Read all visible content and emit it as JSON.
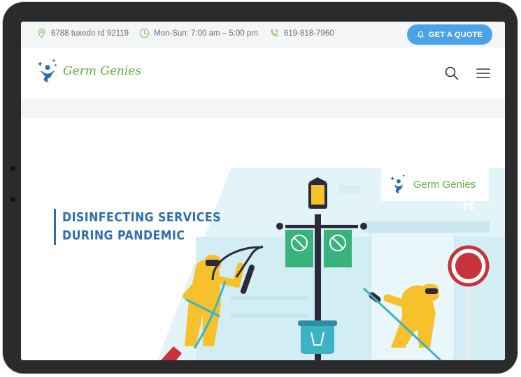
{
  "topbar": {
    "address": "6788 tuxedo rd 92119",
    "hours": "Mon-Sun: 7:00 am – 5:00 pm",
    "phone": "619-818-7960",
    "quote_label": "GET A QUOTE"
  },
  "header": {
    "logo_text": "Germ Genies"
  },
  "hero": {
    "line1": "DISINFECTING SERVICES",
    "line2": "DURING PANDEMIC",
    "badge_text": "Germ Genies",
    "sign_letter": "R"
  },
  "colors": {
    "accent_blue": "#4aa3e6",
    "logo_green": "#6aaa3a",
    "headline_blue": "#2f6db2",
    "suit_yellow": "#f6c12b",
    "banner_green": "#39b37d"
  },
  "icons": [
    "location-icon",
    "clock-icon",
    "phone-icon",
    "bell-icon",
    "search-icon",
    "menu-icon",
    "genie-logo-icon"
  ]
}
